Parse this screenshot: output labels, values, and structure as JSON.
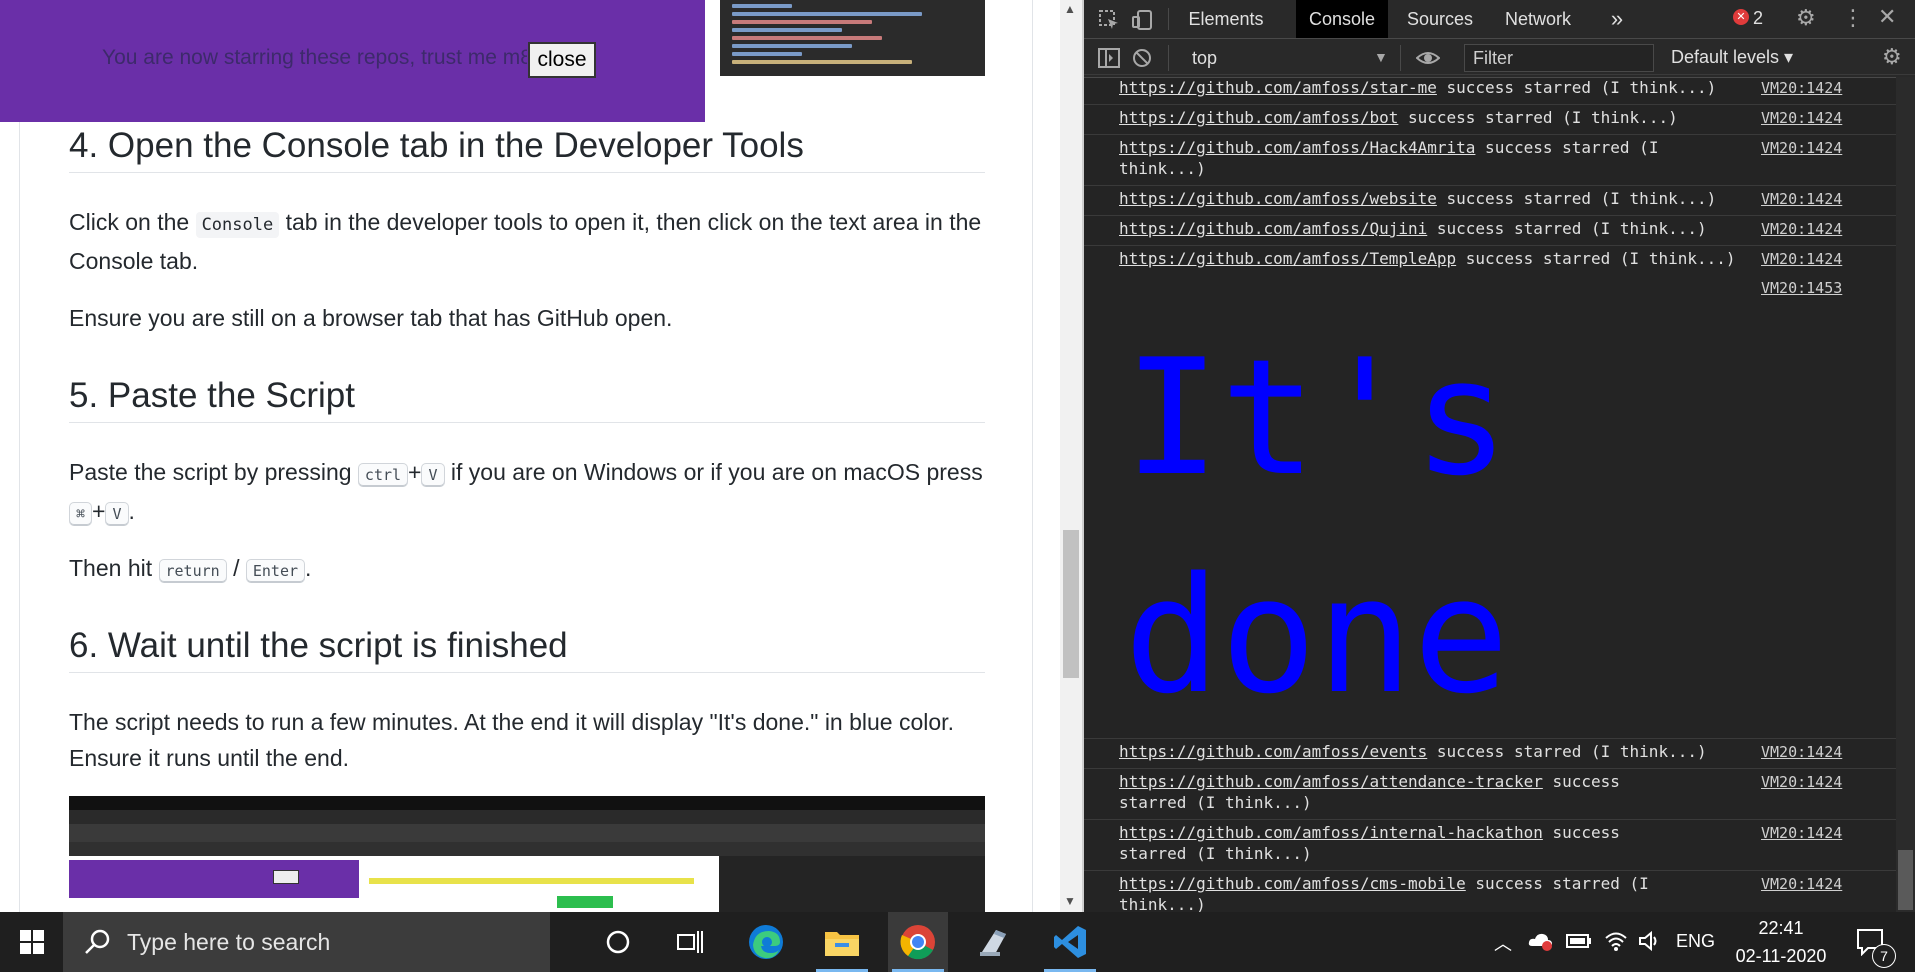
{
  "toast": {
    "text": "You are now starring these repos, trust me m8",
    "close_label": "close"
  },
  "sections": [
    {
      "heading": "4. Open the Console tab in the Developer Tools"
    },
    {
      "heading": "5. Paste the Script"
    },
    {
      "heading": "6. Wait until the script is finished"
    }
  ],
  "p4a": {
    "pre": "Click on the ",
    "code": "Console",
    "post": " tab in the developer tools to open it, then click on the text area in the Console tab."
  },
  "p4b": "Ensure you are still on a browser tab that has GitHub open.",
  "p5a": {
    "pre": "Paste the script by pressing ",
    "k1": "ctrl",
    "plus1": "+",
    "k2": "V",
    "mid": " if you are on Windows or if you are on macOS press ",
    "k3": "⌘",
    "plus2": "+",
    "k4": "V",
    "end": "."
  },
  "p5b": {
    "pre": "Then hit ",
    "k1": "return",
    "slash": " / ",
    "k2": "Enter",
    "end": "."
  },
  "p6": "The script needs to run a few minutes. At the end it will display \"It's done.\" in blue color. Ensure it runs until the end.",
  "devtools": {
    "tabs": [
      "Elements",
      "Console",
      "Sources",
      "Network"
    ],
    "more": "»",
    "error_count": "2",
    "context": "top",
    "filter_placeholder": "Filter",
    "levels": "Default levels ▾",
    "logs_top": [
      {
        "url": "https://github.com/amfoss/star-me",
        "msg": " success starred (I think...)",
        "src": "VM20:1424"
      },
      {
        "url": "https://github.com/amfoss/bot",
        "msg": " success starred (I think...)",
        "src": "VM20:1424"
      },
      {
        "url": "https://github.com/amfoss/Hack4Amrita",
        "msg": " success starred (I think...)",
        "src": "VM20:1424"
      },
      {
        "url": "https://github.com/amfoss/website",
        "msg": " success starred (I think...)",
        "src": "VM20:1424"
      },
      {
        "url": "https://github.com/amfoss/Qujini",
        "msg": " success starred (I think...)",
        "src": "VM20:1424"
      },
      {
        "url": "https://github.com/amfoss/TempleApp",
        "msg": " success starred (I think...)",
        "src": "VM20:1424"
      }
    ],
    "done_src": "VM20:1453",
    "done_line1": "It's",
    "done_line2": "done",
    "logs_bottom": [
      {
        "url": "https://github.com/amfoss/events",
        "msg": " success starred (I think...)",
        "src": "VM20:1424"
      },
      {
        "url": "https://github.com/amfoss/attendance-tracker",
        "msg": " success starred (I think...)",
        "src": "VM20:1424"
      },
      {
        "url": "https://github.com/amfoss/internal-hackathon",
        "msg": " success starred (I think...)",
        "src": "VM20:1424"
      },
      {
        "url": "https://github.com/amfoss/cms-mobile",
        "msg": " success starred (I think...)",
        "src": "VM20:1424"
      }
    ]
  },
  "taskbar": {
    "search_placeholder": "Type here to search",
    "language": "ENG",
    "time": "22:41",
    "date": "02-11-2020",
    "notifications": "7"
  },
  "colors": {
    "toast": "#6a2fa8",
    "done_text": "#0000ff",
    "console_bg": "#242424"
  }
}
